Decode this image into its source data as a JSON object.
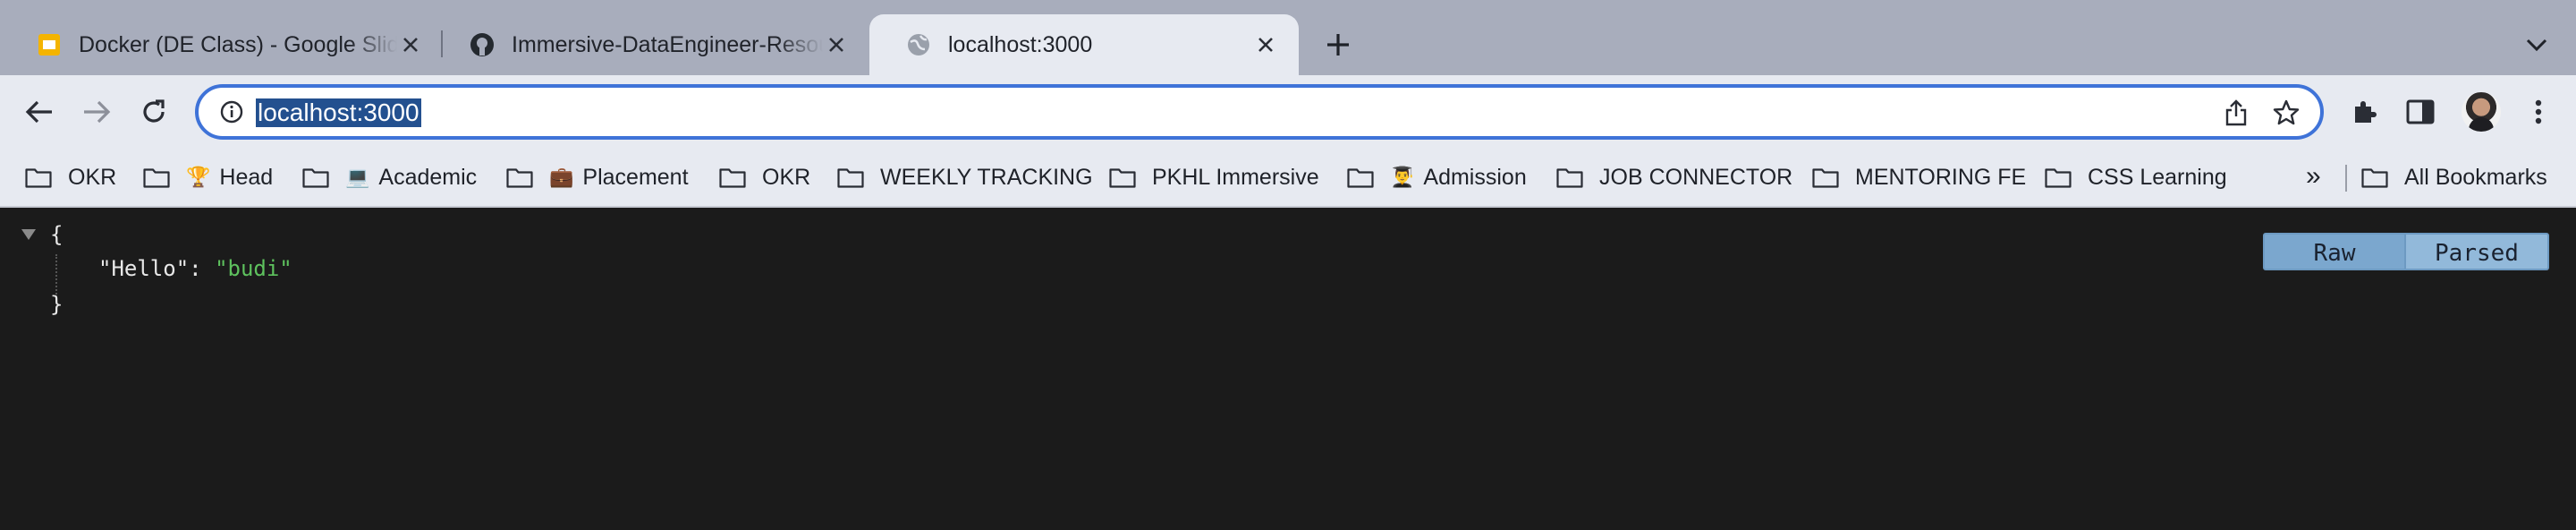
{
  "tabs": [
    {
      "title": "Docker (DE Class) - Google Slides",
      "icon": "slides-icon",
      "active": false
    },
    {
      "title": "Immersive-DataEngineer-Resources",
      "icon": "github-icon",
      "active": false
    },
    {
      "title": "localhost:3000",
      "icon": "globe-icon",
      "active": true
    }
  ],
  "omnibox": {
    "url": "localhost:3000"
  },
  "bookmarks": [
    {
      "label": "OKR",
      "emoji": ""
    },
    {
      "label": "Head",
      "emoji": "🏆"
    },
    {
      "label": "Academic",
      "emoji": "💻"
    },
    {
      "label": "Placement",
      "emoji": "💼"
    },
    {
      "label": "OKR",
      "emoji": ""
    },
    {
      "label": "WEEKLY TRACKING",
      "emoji": ""
    },
    {
      "label": "PKHL Immersive",
      "emoji": ""
    },
    {
      "label": "Admission",
      "emoji": "👨‍🎓"
    },
    {
      "label": "JOB CONNECTOR",
      "emoji": ""
    },
    {
      "label": "MENTORING FE",
      "emoji": ""
    },
    {
      "label": "CSS Learning",
      "emoji": ""
    }
  ],
  "bookmarks_more": "»",
  "all_bookmarks": "All Bookmarks",
  "json_view": {
    "open_brace": "{",
    "close_brace": "}",
    "key": "\"Hello\"",
    "colon": ": ",
    "value": "\"budi\""
  },
  "view_buttons": {
    "raw": "Raw",
    "parsed": "Parsed"
  },
  "colors": {
    "accent": "#3f73d8",
    "string": "#5ec25e",
    "background": "#1b1b1b"
  }
}
